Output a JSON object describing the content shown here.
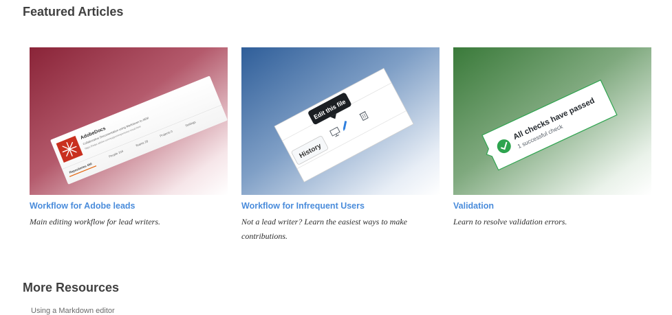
{
  "featured": {
    "title": "Featured Articles",
    "cards": [
      {
        "link": "Workflow for Adobe leads",
        "description": "Main editing workflow for lead writers.",
        "image": {
          "repo_name": "AdobeDocs",
          "repo_desc": "Collaborative Documentation using Markdown to AEM",
          "repo_url": "https://helpx.adobe.com/support/experience-cloud.html",
          "tabs": [
            "People 104",
            "Teams 28",
            "Projects 0",
            "Settings"
          ],
          "active_tab": "Repositories 450",
          "gradient_color": "#8a2438"
        }
      },
      {
        "link": "Workflow for Infrequent Users",
        "description": "Not a lead writer? Learn the easiest ways to make contributions.",
        "image": {
          "history_button": "History",
          "tooltip": "Edit this file",
          "gradient_color": "#2f5e99"
        }
      },
      {
        "link": "Validation",
        "description": "Learn to resolve validation errors.",
        "image": {
          "check_title": "All checks have passed",
          "check_sub": "1 successful check",
          "gradient_color": "#3a7a3a"
        }
      }
    ]
  },
  "more": {
    "title": "More Resources",
    "first_item": "Using a Markdown editor"
  }
}
